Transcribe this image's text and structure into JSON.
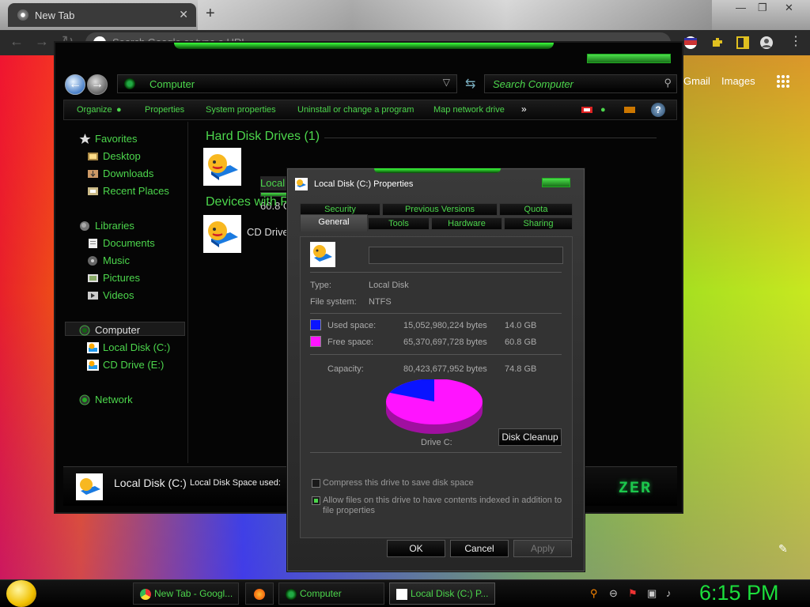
{
  "browser": {
    "tab_title": "New Tab",
    "tab_close": "✕",
    "new_tab": "+",
    "omnibox_placeholder": "Search Google or type a URL",
    "google_links": [
      "Gmail",
      "Images"
    ]
  },
  "explorer": {
    "address": "Computer",
    "search_placeholder": "Search Computer",
    "commands": [
      "Organize",
      "Properties",
      "System properties",
      "Uninstall or change a program",
      "Map network drive",
      "»"
    ],
    "help": "?",
    "nav": {
      "favorites": "Favorites",
      "desktop": "Desktop",
      "downloads": "Downloads",
      "recent": "Recent Places",
      "libraries": "Libraries",
      "documents": "Documents",
      "music": "Music",
      "pictures": "Pictures",
      "videos": "Videos",
      "computer": "Computer",
      "local_disk": "Local Disk (C:)",
      "cd_drive": "CD Drive (E:)",
      "network": "Network"
    },
    "sections": {
      "hdd": "Hard Disk Drives (1)",
      "removable": "Devices with R"
    },
    "drive_c": {
      "name": "Local Disk (C:)",
      "free": "60.8 GB",
      "used_fraction": 0.19
    },
    "drive_e": {
      "name": "CD Drive"
    },
    "details": {
      "name": "Local Disk (C:)",
      "used_label": "Local Disk Space used:"
    },
    "brand": "ZER"
  },
  "dialog": {
    "title": "Local Disk (C:) Properties",
    "tabs_row1": [
      "Security",
      "Previous Versions",
      "Quota"
    ],
    "tabs_row2": [
      "General",
      "Tools",
      "Hardware",
      "Sharing"
    ],
    "type_label": "Type:",
    "type_value": "Local Disk",
    "fs_label": "File system:",
    "fs_value": "NTFS",
    "used": {
      "label": "Used space:",
      "bytes": "15,052,980,224 bytes",
      "size": "14.0 GB",
      "color": "#0a14ff"
    },
    "free": {
      "label": "Free space:",
      "bytes": "65,370,697,728 bytes",
      "size": "60.8 GB",
      "color": "#ff14ff"
    },
    "capacity": {
      "label": "Capacity:",
      "bytes": "80,423,677,952 bytes",
      "size": "74.8 GB"
    },
    "drive_label": "Drive C:",
    "cleanup": "Disk Cleanup",
    "compress": "Compress this drive to save disk space",
    "compress_checked": false,
    "index": "Allow files on this drive to have contents indexed in addition to file properties",
    "index_checked": true,
    "ok": "OK",
    "cancel": "Cancel",
    "apply": "Apply"
  },
  "taskbar": {
    "items": [
      "New Tab - Googl...",
      "Computer",
      "Local Disk (C:) P..."
    ],
    "clock": "6:15 PM"
  }
}
